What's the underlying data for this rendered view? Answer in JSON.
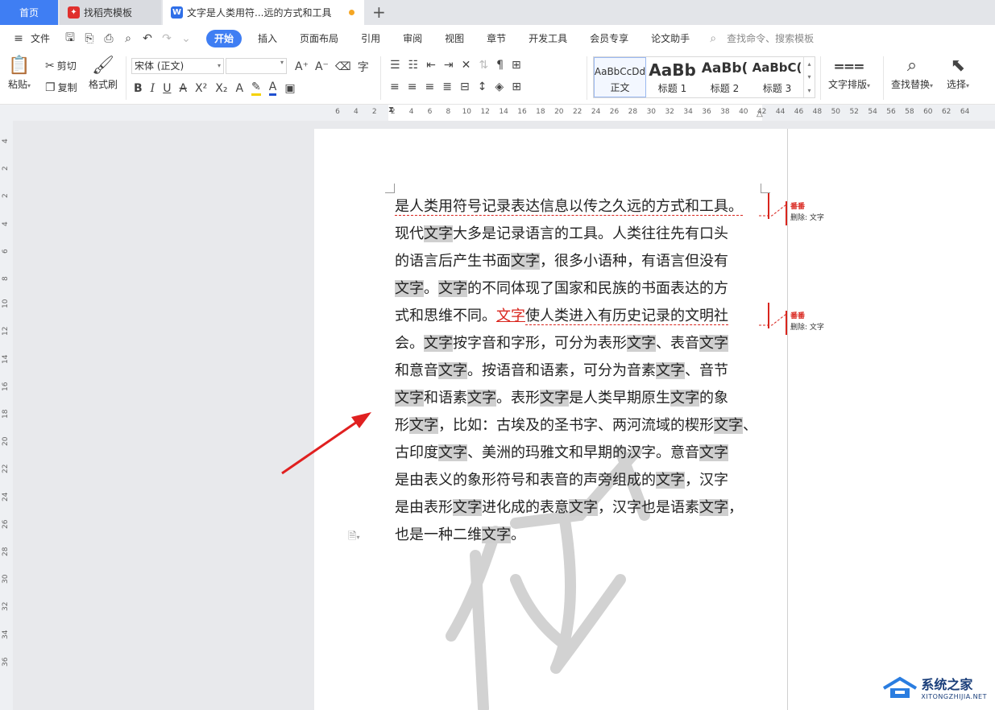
{
  "tabs": {
    "home": "首页",
    "template": "找稻壳模板",
    "doc": "文字是人类用符...远的方式和工具"
  },
  "menu": {
    "file": "文件",
    "items": [
      "开始",
      "插入",
      "页面布局",
      "引用",
      "审阅",
      "视图",
      "章节",
      "开发工具",
      "会员专享",
      "论文助手"
    ],
    "search": "查找命令、搜索模板"
  },
  "ribbon": {
    "paste": "粘贴",
    "cut": "剪切",
    "copy": "复制",
    "format_painter": "格式刷",
    "font_name": "宋体 (正文)",
    "styles": [
      {
        "sample": "AaBbCcDd",
        "name": "正文"
      },
      {
        "sample": "AaBb",
        "name": "标题 1"
      },
      {
        "sample": "AaBb(",
        "name": "标题 2"
      },
      {
        "sample": "AaBbC(",
        "name": "标题 3"
      }
    ],
    "text_layout": "文字排版",
    "find_replace": "查找替换",
    "select": "选择"
  },
  "ruler": {
    "h_ticks": [
      "6",
      "4",
      "2",
      "2",
      "4",
      "6",
      "8",
      "10",
      "12",
      "14",
      "16",
      "18",
      "20",
      "22",
      "24",
      "26",
      "28",
      "30",
      "32",
      "34",
      "36",
      "38",
      "40",
      "42",
      "44",
      "46",
      "48",
      "50",
      "52",
      "54",
      "56",
      "58",
      "60",
      "62",
      "64"
    ],
    "v_ticks": [
      "4",
      "2",
      "2",
      "4",
      "6",
      "8",
      "10",
      "12",
      "14",
      "16",
      "18",
      "20",
      "22",
      "24",
      "26",
      "28",
      "30",
      "32",
      "34",
      "36"
    ]
  },
  "document": {
    "lines": [
      [
        {
          "t": "是人类用符号记录表达信息以传之久远的方式和工具。",
          "c": "del"
        }
      ],
      [
        {
          "t": "现代"
        },
        {
          "t": "文字",
          "c": "hl"
        },
        {
          "t": "大多是记录语言的工具。人类往往先有口头"
        }
      ],
      [
        {
          "t": "的语言后产生书面"
        },
        {
          "t": "文字",
          "c": "hl"
        },
        {
          "t": "，很多小语种，有语言但没有"
        }
      ],
      [
        {
          "t": "文字",
          "c": "hl"
        },
        {
          "t": "。"
        },
        {
          "t": "文字",
          "c": "hl"
        },
        {
          "t": "的不同体现了国家和民族的书面表达的方"
        }
      ],
      [
        {
          "t": "式和思维不同。"
        },
        {
          "t": "文字",
          "c": "ins"
        },
        {
          "t": "使人类进入有历史记录的文明社",
          "c": "del"
        }
      ],
      [
        {
          "t": "会。"
        },
        {
          "t": "文字",
          "c": "hl"
        },
        {
          "t": "按字音和字形，可分为表形"
        },
        {
          "t": "文字",
          "c": "hl"
        },
        {
          "t": "、表音"
        },
        {
          "t": "文字",
          "c": "hl"
        }
      ],
      [
        {
          "t": "和意音"
        },
        {
          "t": "文字",
          "c": "hl"
        },
        {
          "t": "。按语音和语素，可分为音素"
        },
        {
          "t": "文字",
          "c": "hl"
        },
        {
          "t": "、音节"
        }
      ],
      [
        {
          "t": "文字",
          "c": "hl"
        },
        {
          "t": "和语素"
        },
        {
          "t": "文字",
          "c": "hl"
        },
        {
          "t": "。表形"
        },
        {
          "t": "文字",
          "c": "hl"
        },
        {
          "t": "是人类早期原生"
        },
        {
          "t": "文字",
          "c": "hl"
        },
        {
          "t": "的象"
        }
      ],
      [
        {
          "t": "形"
        },
        {
          "t": "文字",
          "c": "hl"
        },
        {
          "t": "，比如：古埃及的圣书字、两河流域的楔形"
        },
        {
          "t": "文字",
          "c": "hl"
        },
        {
          "t": "、"
        }
      ],
      [
        {
          "t": "古印度"
        },
        {
          "t": "文字",
          "c": "hl"
        },
        {
          "t": "、美洲的玛雅文和早期的汉字。意音"
        },
        {
          "t": "文字",
          "c": "hl"
        }
      ],
      [
        {
          "t": "是由表义的象形符号和表音的声旁组成的"
        },
        {
          "t": "文字",
          "c": "hl"
        },
        {
          "t": "，汉字"
        }
      ],
      [
        {
          "t": "是由表形"
        },
        {
          "t": "文字",
          "c": "hl"
        },
        {
          "t": "进化成的表意"
        },
        {
          "t": "文字",
          "c": "hl"
        },
        {
          "t": "，汉字也是语素"
        },
        {
          "t": "文字",
          "c": "hl"
        },
        {
          "t": "，"
        }
      ],
      [
        {
          "t": "也是一种二维"
        },
        {
          "t": "文字",
          "c": "hl"
        },
        {
          "t": "。"
        }
      ]
    ]
  },
  "comments": [
    {
      "author": "番番",
      "action": "删除: 文字"
    },
    {
      "author": "番番",
      "action": "删除: 文字"
    }
  ],
  "watermark": {
    "title": "系统之家",
    "url": "XITONGZHIJIA.NET"
  },
  "colors": {
    "accent": "#3f7ef3",
    "revision": "#d9251d",
    "arrow": "#e02020"
  }
}
